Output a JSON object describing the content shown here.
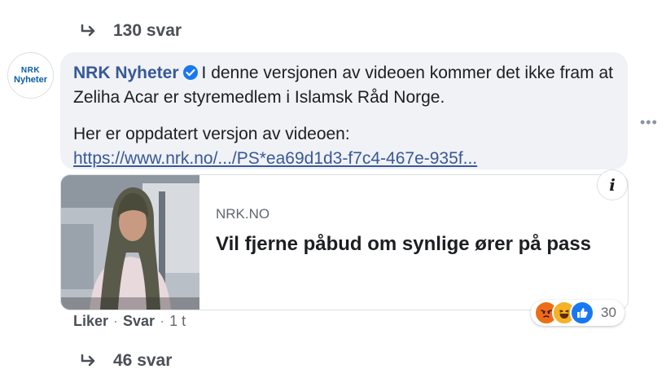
{
  "replies_top": {
    "label": "130 svar"
  },
  "comment": {
    "avatar_line1": "NRK",
    "avatar_line2": "Nyheter",
    "author": "NRK Nyheter",
    "text1": "I denne versjonen av videoen kommer det ikke fram at Zeliha Acar er styremedlem i Islamsk Råd Norge.",
    "text2": "Her er oppdatert versjon av videoen:",
    "link": "https://www.nrk.no/.../PS*ea69d1d3-f7c4-467e-935f..."
  },
  "preview": {
    "domain": "NRK.NO",
    "headline": "Vil fjerne påbud om synlige ører på pass",
    "info_label": "i"
  },
  "actions": {
    "like": "Liker",
    "reply": "Svar",
    "time": "1 t",
    "separator": "·"
  },
  "reactions": {
    "count": "30",
    "icons": [
      "angry-emoji-icon",
      "haha-emoji-icon",
      "like-thumb-icon"
    ]
  },
  "replies_bottom": {
    "label": "46 svar"
  },
  "colors": {
    "link": "#385898",
    "bubble": "#f0f2f5",
    "like": "#1877f2",
    "angry": "#e9710f",
    "haha": "#f7b125"
  }
}
